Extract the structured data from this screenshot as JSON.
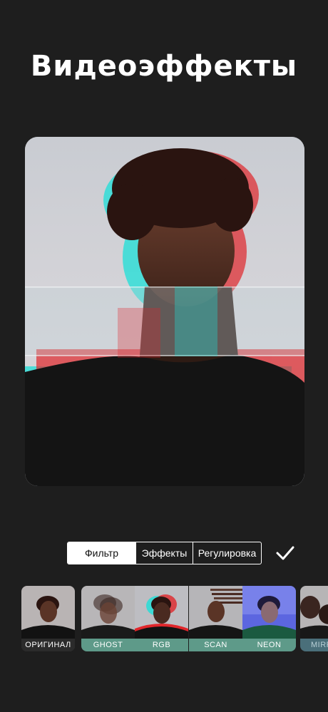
{
  "header": {
    "title": "Видеоэффекты"
  },
  "tabs": [
    {
      "label": "Фильтр",
      "active": true
    },
    {
      "label": "Эффекты",
      "active": false
    },
    {
      "label": "Регулировка",
      "active": false
    }
  ],
  "confirm_icon": "checkmark-icon",
  "filters": [
    {
      "label": "ОРИГИНАЛ"
    },
    {
      "label": "GHOST"
    },
    {
      "label": "RGB"
    },
    {
      "label": "SCAN"
    },
    {
      "label": "NEON"
    },
    {
      "label": "MIRR"
    }
  ],
  "colors": {
    "background": "#1e1e1e",
    "filter_label_green": "#5e9a89",
    "glitch_red": "#e0262b",
    "glitch_cyan": "#1de0d8"
  }
}
